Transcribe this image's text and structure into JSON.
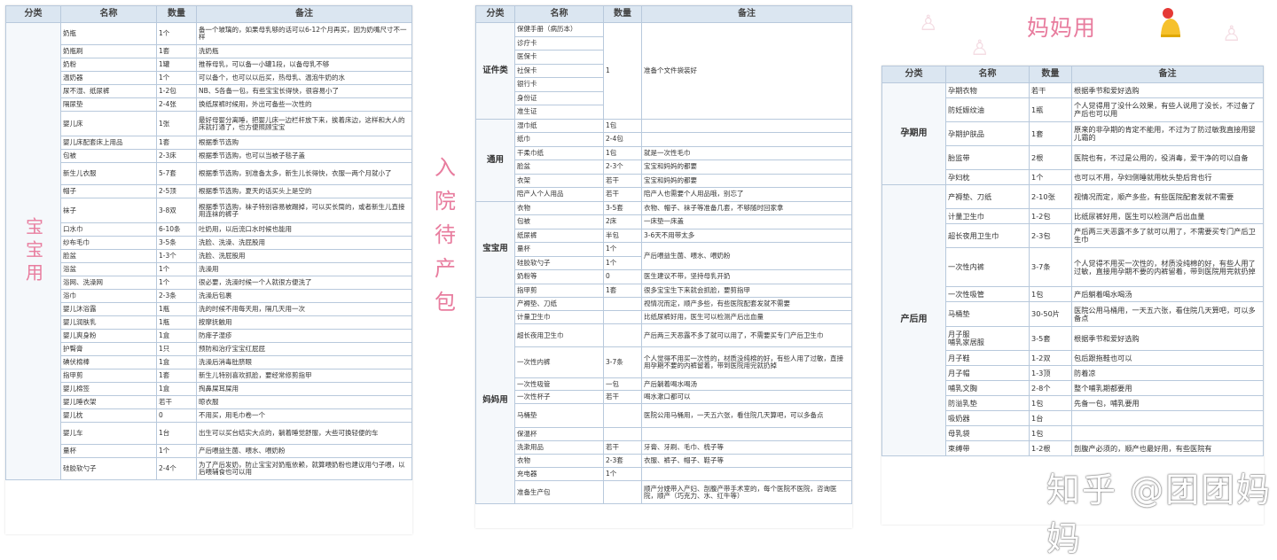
{
  "headers": {
    "category": "分类",
    "name": "名称",
    "qty": "数量",
    "note": "备注"
  },
  "baby": {
    "group": "宝宝用",
    "rows": [
      [
        "奶瓶",
        "1个",
        "备一个玻璃的，如果母乳够的话可以6-12个月再买，因为奶嘴尺寸不一样"
      ],
      [
        "奶瓶刷",
        "1套",
        "洗奶瓶"
      ],
      [
        "奶粉",
        "1罐",
        "推荐母乳，可以备一小罐1段，以备母乳不够"
      ],
      [
        "温奶器",
        "1个",
        "可以备个，也可以以后买，热母乳、温泡牛奶的水"
      ],
      [
        "尿不湿、纸尿裤",
        "1-2包",
        "NB、S各备一包，有些宝宝长得快，很容易小了"
      ],
      [
        "隔尿垫",
        "2-4张",
        "换纸尿裤时候用，外出可备些一次性的"
      ],
      [
        "婴儿床",
        "1张",
        "最好母婴分离睡，把婴儿床一边栏杆放下来，挨着床边，这样和大人的床就打通了，也方便照顾宝宝"
      ],
      [
        "婴儿床配套床上用品",
        "1套",
        "根据季节选购"
      ],
      [
        "包被",
        "2-3床",
        "根据季节选购，也可以当被子毯子盖"
      ],
      [
        "新生儿衣服",
        "5-7套",
        "根据季节选购，别准备太多，新生儿长得快，衣服一两个月就小了"
      ],
      [
        "帽子",
        "2-5顶",
        "根据季节选购，夏天的话买头上是空的"
      ],
      [
        "袜子",
        "3-8双",
        "根据季节选购，袜子特别容易被踢掉，可以买长筒的，或者新生儿直接用连袜的裤子"
      ],
      [
        "口水巾",
        "6-10条",
        "吐奶用，以后流口水时候也能用"
      ],
      [
        "纱布毛巾",
        "3-5条",
        "洗脸、洗澡、洗屁股用"
      ],
      [
        "脸盆",
        "1-3个",
        "洗脸、洗屁股用"
      ],
      [
        "浴盆",
        "1个",
        "洗澡用"
      ],
      [
        "浴网、洗澡网",
        "1个",
        "很必要，洗澡时候一个人就很方便洗了"
      ],
      [
        "浴巾",
        "2-3条",
        "洗澡后包裹"
      ],
      [
        "婴儿沐浴露",
        "1瓶",
        "洗的时候不用每天用，隔几天用一次"
      ],
      [
        "婴儿润肤乳",
        "1瓶",
        "按摩抚触用"
      ],
      [
        "婴儿爽身粉",
        "1盒",
        "防痱子湿疹"
      ],
      [
        "护臀膏",
        "1只",
        "预防和治疗宝宝红屁屁"
      ],
      [
        "碘伏棉棒",
        "1盒",
        "洗澡后消毒肚脐眼"
      ],
      [
        "指甲剪",
        "1套",
        "新生儿特别喜欢抓脸，要经常修剪指甲"
      ],
      [
        "婴儿棉签",
        "1盒",
        "掏鼻屎耳屎用"
      ],
      [
        "婴儿睡衣架",
        "若干",
        "晾衣服"
      ],
      [
        "婴儿枕",
        "0",
        "不用买，用毛巾卷一个"
      ],
      [
        "婴儿车",
        "1台",
        "出生可以买台结实大点的，躺着睡觉舒服，大些可换轻便的车"
      ],
      [
        "量杯",
        "1个",
        "产后喂益生菌、喂水、喂奶粉"
      ],
      [
        "硅胶软勺子",
        "2-4个",
        "为了产后发奶，防止宝宝对奶瓶依赖，就算喂奶粉也建议用勺子喂，以后喂辅食也可以用"
      ]
    ]
  },
  "bag": {
    "title": [
      "入",
      "院",
      "待",
      "产",
      "包"
    ],
    "cert": {
      "group": "证件类",
      "items": [
        "保健手册（病历本）",
        "诊疗卡",
        "医保卡",
        "社保卡",
        "银行卡",
        "身份证",
        "准生证"
      ],
      "qty": "1",
      "note": "准备个文件袋装好"
    },
    "general": {
      "group": "通用",
      "rows": [
        [
          "湿巾纸",
          "1包",
          ""
        ],
        [
          "纸巾",
          "2-4包",
          ""
        ],
        [
          "干柔巾纸",
          "1包",
          "就是一次性毛巾"
        ],
        [
          "脸盆",
          "2-3个",
          "宝宝和妈妈的都要"
        ],
        [
          "衣架",
          "若干",
          "宝宝和妈妈的都要"
        ],
        [
          "陪产人个人用品",
          "若干",
          "陪产人也需要个人用品哦，别忘了"
        ]
      ]
    },
    "baby": {
      "group": "宝宝用",
      "rows": [
        [
          "衣物",
          "3-5套",
          "衣物、帽子、袜子等准备几套，不够随时回家拿"
        ],
        [
          "包被",
          "2床",
          "一床垫一床盖"
        ],
        [
          "纸尿裤",
          "半包",
          "3-6天不用带太多"
        ]
      ],
      "cupRows": [
        [
          "量杯",
          "1个"
        ],
        [
          "硅胶软勺子",
          "1个"
        ]
      ],
      "cupNote": "产后喂益生菌、喂水、喂奶粉",
      "tail": [
        [
          "奶粉等",
          "0",
          "医生建议不带，坚持母乳开奶"
        ],
        [
          "指甲剪",
          "1套",
          "很多宝宝生下来就会抓脸，要剪指甲"
        ]
      ]
    },
    "mom": {
      "group": "妈妈用",
      "rows": [
        [
          "产褥垫、刀纸",
          "",
          "视情况而定，顺产多些，有些医院配套发就不需要"
        ],
        [
          "计量卫生巾",
          "",
          "比纸尿裤好用，医生可以检测产后出血量"
        ],
        [
          "超长夜用卫生巾",
          "",
          "产后两三天恶露不多了就可以用了，不需要买专门产后卫生巾"
        ],
        [
          "一次性内裤",
          "3-7条",
          "个人觉得不用买一次性的，材质没纯棉的好，有些人用了过敏，直接用孕期不要的内裤留着，带到医院用完就扔掉"
        ],
        [
          "一次性吸管",
          "一包",
          "产后躺着喝水喝汤"
        ],
        [
          "一次性杯子",
          "若干",
          "喝水漱口都可以"
        ],
        [
          "马桶垫",
          "",
          "医院公用马桶用，一天五六张，看住院几天算吧，可以多备点"
        ],
        [
          "保温杯",
          "",
          ""
        ],
        [
          "洗漱用品",
          "若干",
          "牙膏、牙刷、毛巾、梳子等"
        ],
        [
          "衣物",
          "2-3套",
          "衣服、裤子、帽子、鞋子等"
        ],
        [
          "充电器",
          "1个",
          ""
        ],
        [
          "准备生产包",
          "",
          "顺产分娩带入产妇、剖腹产带手术室的，每个医院不医院，咨询医院，顺产（巧克力、水、红牛等）"
        ]
      ]
    }
  },
  "mom": {
    "title": "妈妈用",
    "preg": {
      "group": "孕期用",
      "rows": [
        [
          "孕期衣物",
          "若干",
          "根据季节和爱好选购"
        ],
        [
          "防妊娠纹油",
          "1瓶",
          "个人觉得用了没什么效果，有些人说用了没长，不过备了产后也可以用"
        ],
        [
          "孕期护肤品",
          "1套",
          "原来的非孕期的肯定不能用，不过为了防过敏我直接用婴儿霜的"
        ],
        [
          "胎监带",
          "2根",
          "医院也有，不过是公用的，役消毒，爱干净的可以自备"
        ],
        [
          "孕妇枕",
          "1个",
          "也可以不用，孕妇侧睡就用枕头垫后背也行"
        ]
      ]
    },
    "post": {
      "group": "产后用",
      "rows": [
        [
          "产褥垫、刀纸",
          "2-10张",
          "视情况而定，顺产多些，有些医院配套发就不需要"
        ],
        [
          "计量卫生巾",
          "1-2包",
          "比纸尿裤好用，医生可以检测产后出血量"
        ],
        [
          "超长夜用卫生巾",
          "2-3包",
          "产后两三天恶露不多了就可以用了，不需要买专门产后卫生巾"
        ],
        [
          "一次性内裤",
          "3-7条",
          "个人觉得不用买一次性的，材质没纯棉的好，有些人用了过敏，直接用孕期不要的内裤留着，带到医院用完就扔掉"
        ],
        [
          "一次性吸管",
          "1包",
          "产后躺着喝水喝汤"
        ],
        [
          "马桶垫",
          "30-50片",
          "医院公用马桶用，一天五六张，看住院几天算吧，可以多备点"
        ],
        [
          "月子服\n哺乳家居服",
          "3-5套",
          "根据季节和爱好选购"
        ],
        [
          "月子鞋",
          "1-2双",
          "包后跟拖鞋也可以"
        ],
        [
          "月子帽",
          "1-3顶",
          "防着凉"
        ],
        [
          "哺乳文胸",
          "2-8个",
          "整个哺乳期都要用"
        ],
        [
          "防溢乳垫",
          "1包",
          "先备一包，哺乳要用"
        ],
        [
          "吸奶器",
          "1台",
          ""
        ],
        [
          "母乳袋",
          "1包",
          ""
        ],
        [
          "束缚带",
          "1-2根",
          "剖腹产必须的，顺产也最好用，有些医院有"
        ]
      ]
    }
  },
  "watermark": "知乎 @团团妈妈"
}
